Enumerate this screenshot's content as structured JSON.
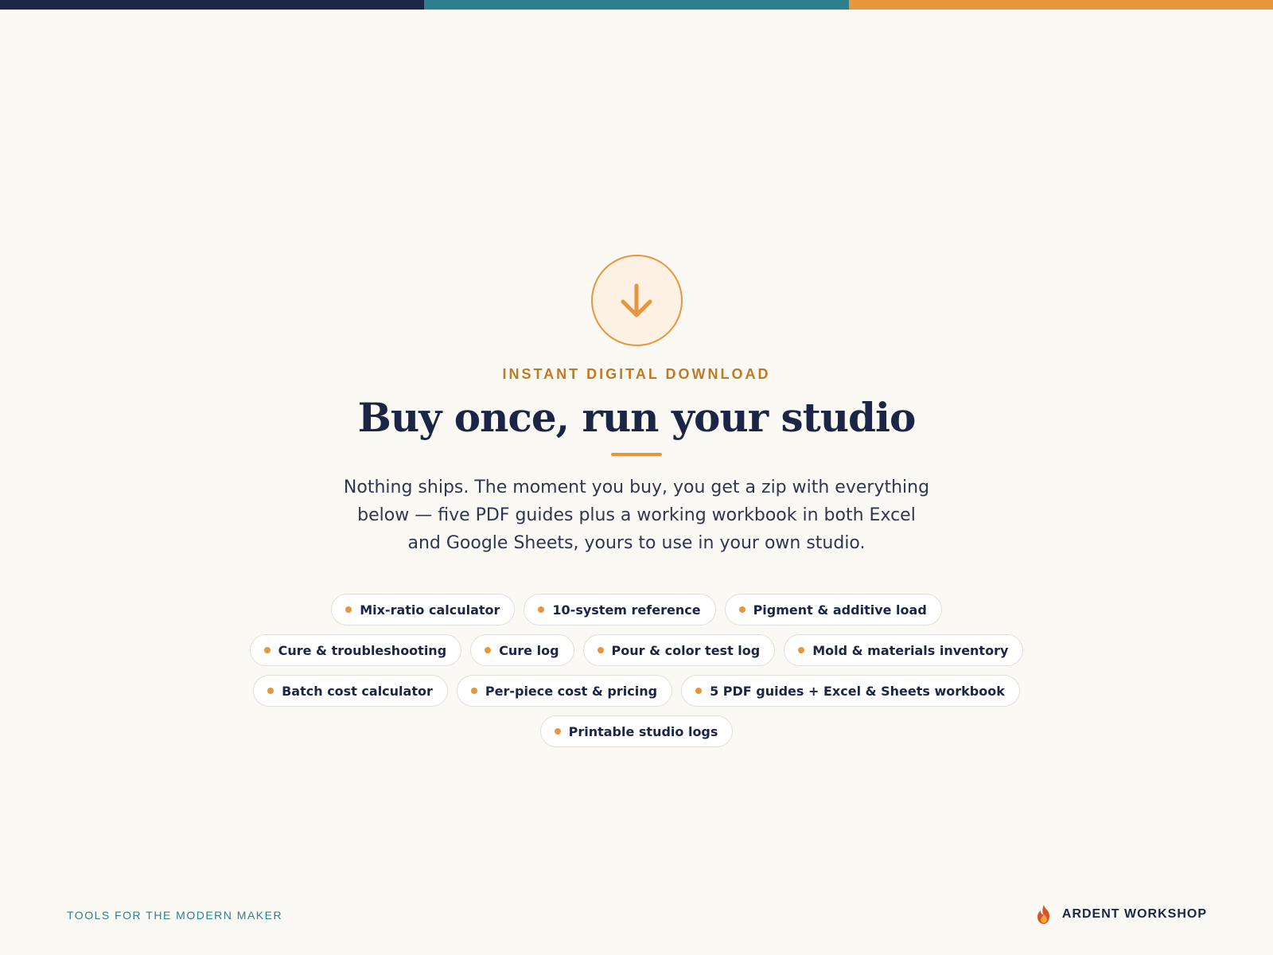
{
  "colors": {
    "navy": "#1b2545",
    "teal": "#2e7f8e",
    "orange": "#e8963e",
    "background": "#fbf9f4"
  },
  "hero": {
    "icon": "download-arrow-icon",
    "eyebrow": "INSTANT DIGITAL DOWNLOAD",
    "title": "Buy once, run your studio",
    "description": "Nothing ships. The moment you buy, you get a zip with everything below — five PDF guides plus a working workbook in both Excel and Google Sheets, yours to use in your own studio."
  },
  "chips": [
    "Mix-ratio calculator",
    "10-system reference",
    "Pigment & additive load",
    "Cure & troubleshooting",
    "Cure log",
    "Pour & color test log",
    "Mold & materials inventory",
    "Batch cost calculator",
    "Per-piece cost & pricing",
    "5 PDF guides + Excel & Sheets workbook",
    "Printable studio logs"
  ],
  "footer": {
    "tagline": "TOOLS FOR THE MODERN MAKER",
    "brand_icon": "flame-logo-icon",
    "brand": "ARDENT WORKSHOP"
  }
}
